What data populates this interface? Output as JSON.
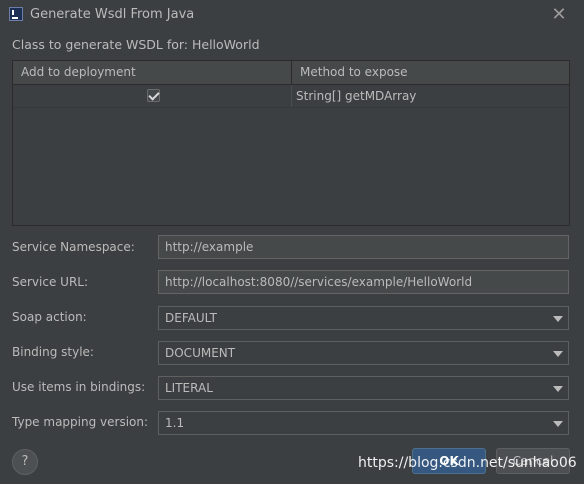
{
  "window": {
    "title": "Generate Wsdl From Java",
    "logo_icon": "intellij-logo",
    "close_icon": "close-icon"
  },
  "class_label": "Class to generate WSDL for: HelloWorld",
  "table": {
    "columns": [
      "Add to deployment",
      "Method to expose"
    ],
    "rows": [
      {
        "add_to_deployment": true,
        "method": "String[] getMDArray"
      }
    ]
  },
  "form": {
    "service_namespace": {
      "label": "Service Namespace:",
      "value": "http://example"
    },
    "service_url": {
      "label": "Service URL:",
      "value": "http://localhost:8080//services/example/HelloWorld"
    },
    "soap_action": {
      "label": "Soap action:",
      "value": "DEFAULT"
    },
    "binding_style": {
      "label": "Binding style:",
      "value": "DOCUMENT"
    },
    "use_items": {
      "label": "Use items in bindings:",
      "value": "LITERAL"
    },
    "type_mapping": {
      "label": "Type mapping version:",
      "value": "1.1"
    }
  },
  "buttons": {
    "help": "?",
    "ok": "OK",
    "cancel": "Cancel"
  },
  "watermark": "https://blog.csdn.net/sunhao06",
  "colors": {
    "background": "#3c3f41",
    "text": "#bbbbbb",
    "field_bg": "#45494a",
    "ok_button": "#365880"
  }
}
